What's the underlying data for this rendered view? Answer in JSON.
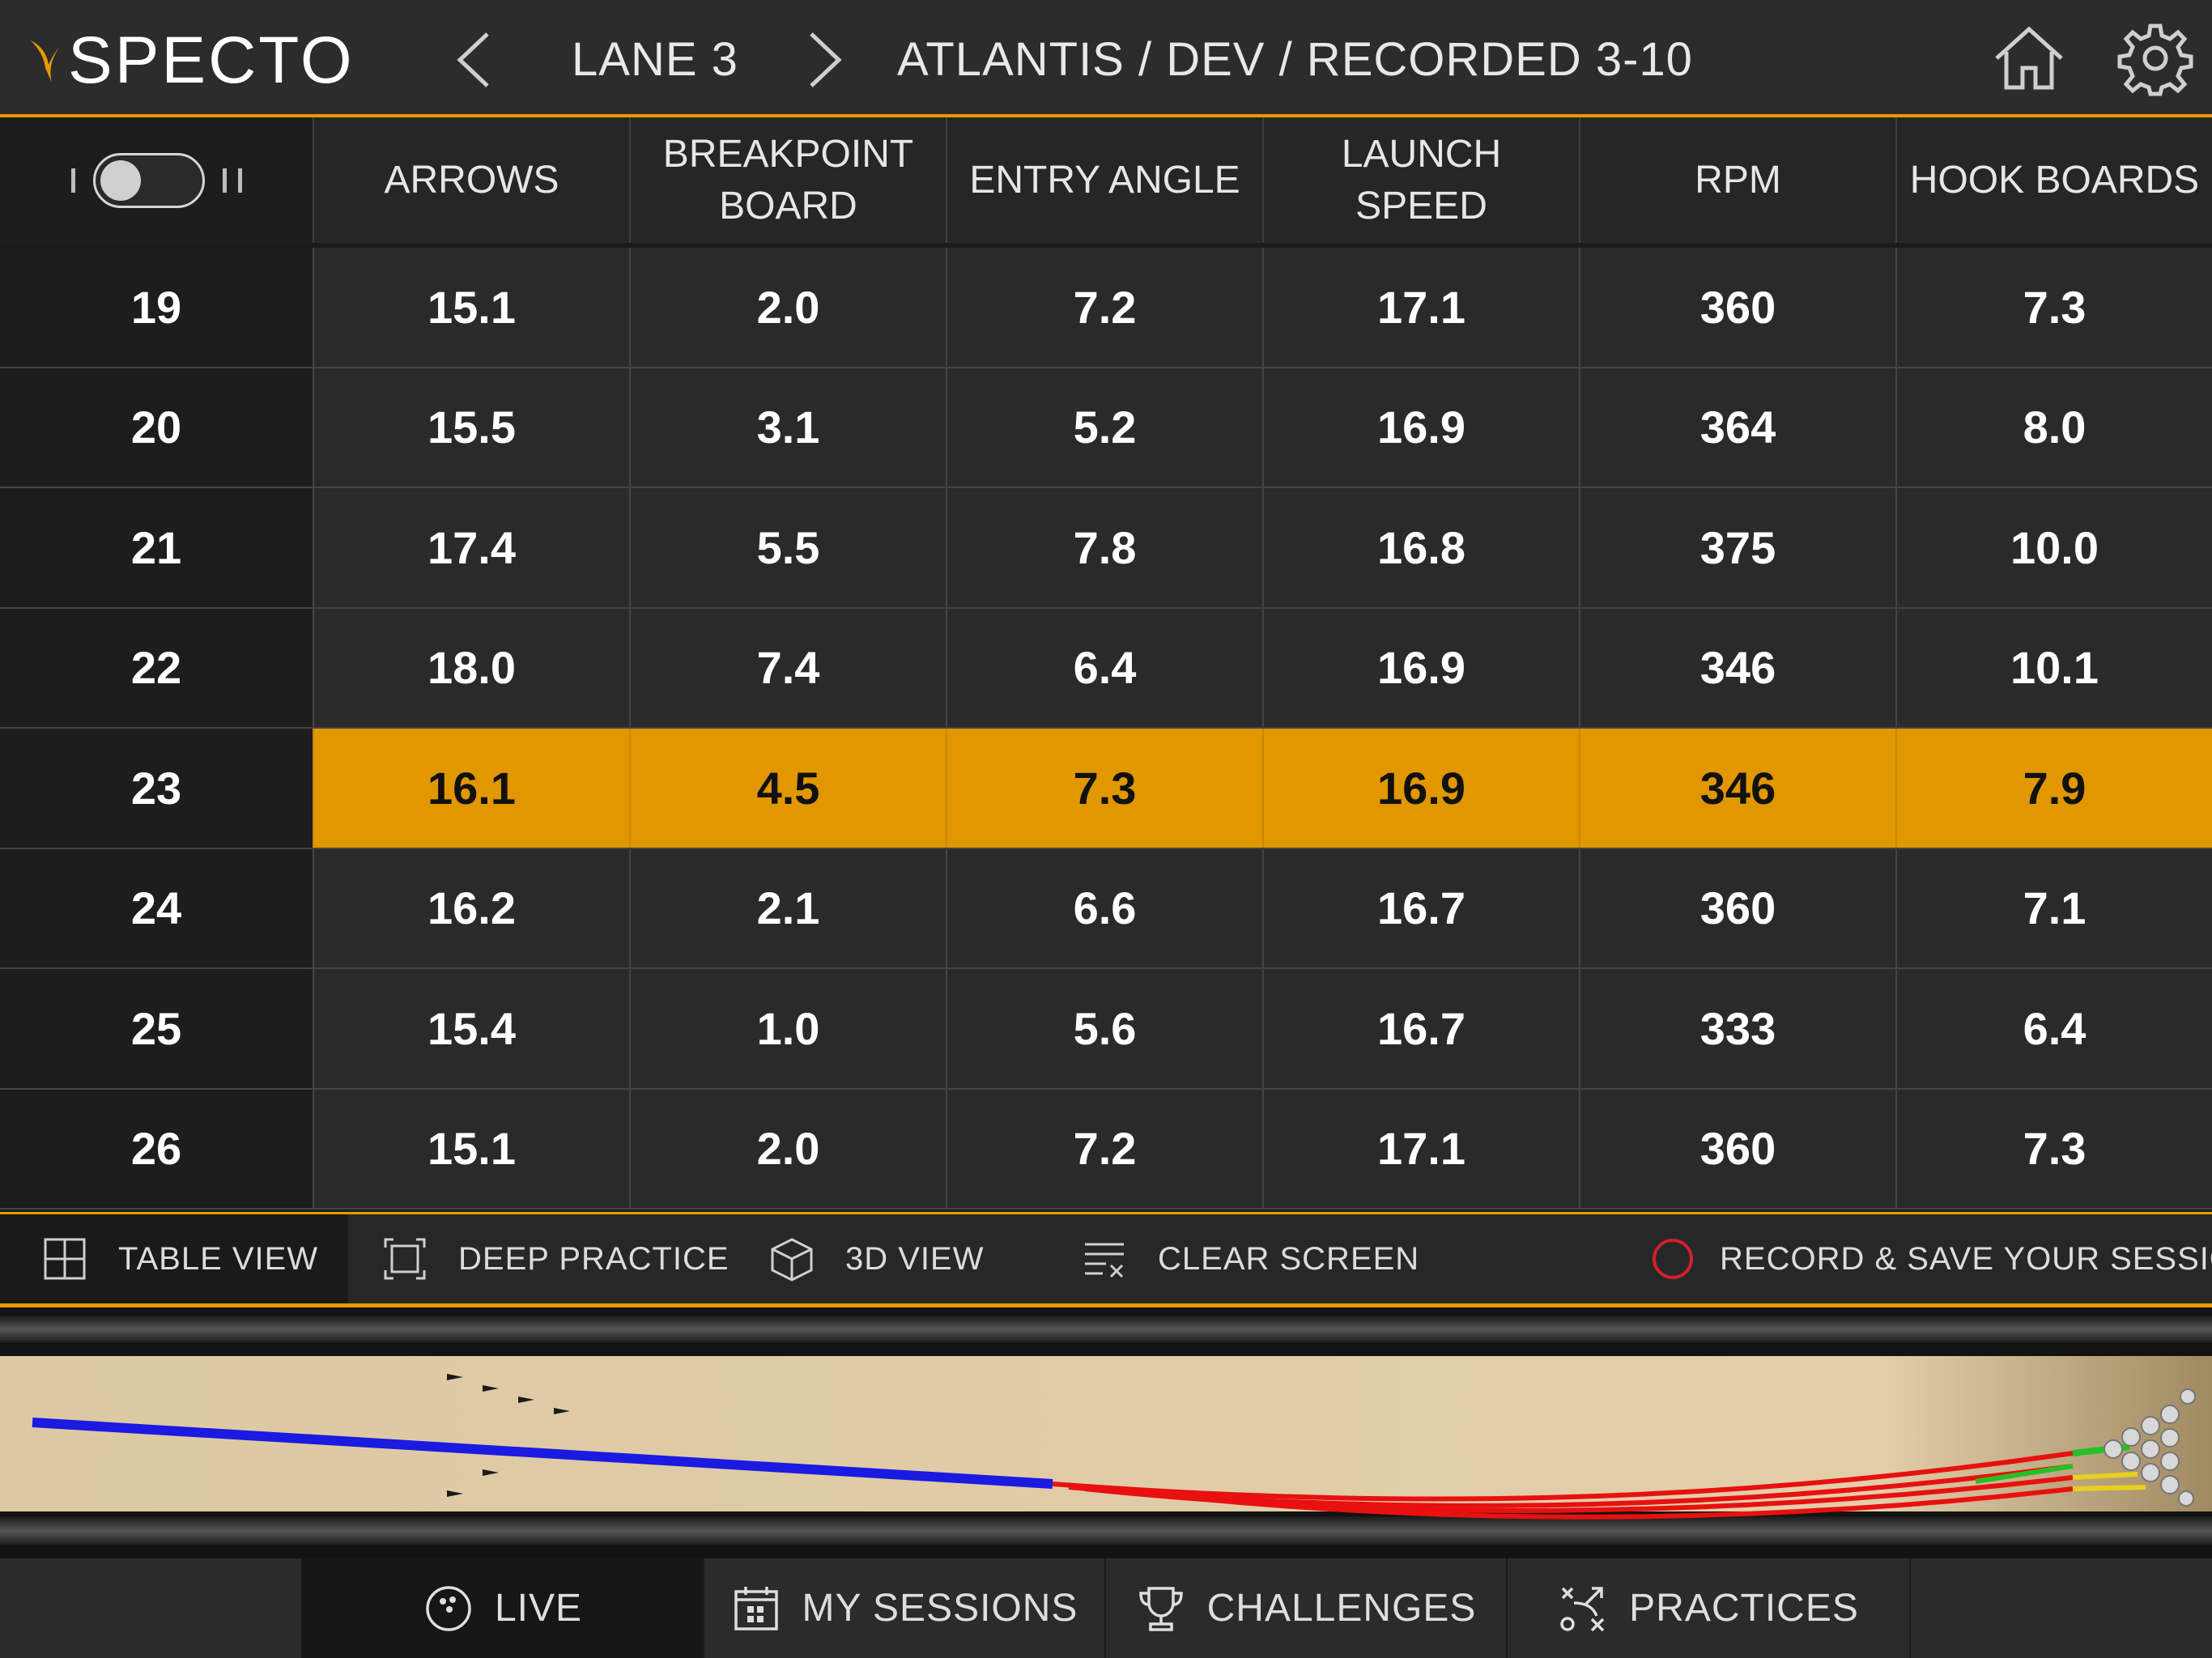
{
  "header": {
    "logo_text": "SPECTO",
    "lane_label": "LANE 3",
    "breadcrumb": "ATLANTIS / DEV / RECORDED 3-10",
    "icons": [
      "back-arrow-icon",
      "forward-arrow-icon",
      "home-icon",
      "gear-icon"
    ]
  },
  "table": {
    "columns": [
      "ARROWS",
      "BREAKPOINT BOARD",
      "ENTRY ANGLE",
      "LAUNCH SPEED",
      "RPM",
      "HOOK BOARDS"
    ],
    "rows": [
      {
        "frame": "19",
        "arrows": "15.1",
        "breakpoint": "2.0",
        "entry": "7.2",
        "launch": "17.1",
        "rpm": "360",
        "hook": "7.3"
      },
      {
        "frame": "20",
        "arrows": "15.5",
        "breakpoint": "3.1",
        "entry": "5.2",
        "launch": "16.9",
        "rpm": "364",
        "hook": "8.0"
      },
      {
        "frame": "21",
        "arrows": "17.4",
        "breakpoint": "5.5",
        "entry": "7.8",
        "launch": "16.8",
        "rpm": "375",
        "hook": "10.0"
      },
      {
        "frame": "22",
        "arrows": "18.0",
        "breakpoint": "7.4",
        "entry": "6.4",
        "launch": "16.9",
        "rpm": "346",
        "hook": "10.1"
      },
      {
        "frame": "23",
        "arrows": "16.1",
        "breakpoint": "4.5",
        "entry": "7.3",
        "launch": "16.9",
        "rpm": "346",
        "hook": "7.9"
      },
      {
        "frame": "24",
        "arrows": "16.2",
        "breakpoint": "2.1",
        "entry": "6.6",
        "launch": "16.7",
        "rpm": "360",
        "hook": "7.1"
      },
      {
        "frame": "25",
        "arrows": "15.4",
        "breakpoint": "1.0",
        "entry": "5.6",
        "launch": "16.7",
        "rpm": "333",
        "hook": "6.4"
      },
      {
        "frame": "26",
        "arrows": "15.1",
        "breakpoint": "2.0",
        "entry": "7.2",
        "launch": "17.1",
        "rpm": "360",
        "hook": "7.3"
      }
    ],
    "highlight_color": "#e09700"
  },
  "toolbar": {
    "table_view": "TABLE VIEW",
    "deep_practice": "DEEP PRACTICE",
    "view_3d": "3D VIEW",
    "clear_screen": "CLEAR SCREEN",
    "record": "RECORD & SAVE YOUR SESSION"
  },
  "nav": {
    "live": "LIVE",
    "my_sessions": "MY SESSIONS",
    "challenges": "CHALLENGES",
    "practices": "PRACTICES"
  },
  "colors": {
    "accent": "#e69a00",
    "record": "#d0202a",
    "path_before_breakpoint": "#1a1ae0",
    "path_after_breakpoint": "#e81010"
  }
}
